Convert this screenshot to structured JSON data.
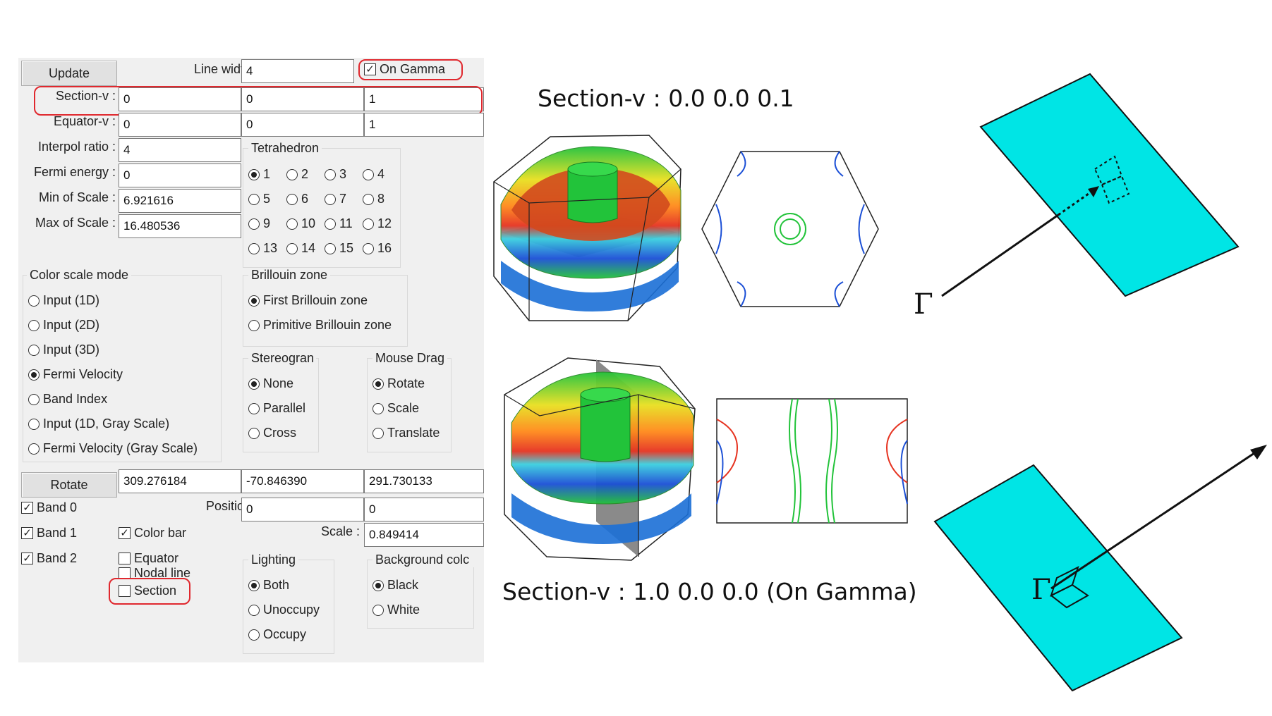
{
  "panel": {
    "update_button": "Update",
    "line_width": {
      "label": "Line width :",
      "value": "4"
    },
    "on_gamma": {
      "label": "On Gamma",
      "checked": true
    },
    "section_v": {
      "label": "Section-v :",
      "values": [
        "0",
        "0",
        "1"
      ]
    },
    "equator_v": {
      "label": "Equator-v :",
      "values": [
        "0",
        "0",
        "1"
      ]
    },
    "interpol_ratio": {
      "label": "Interpol ratio :",
      "value": "4"
    },
    "fermi_energy": {
      "label": "Fermi energy :",
      "value": "0"
    },
    "min_scale": {
      "label": "Min of Scale :",
      "value": "6.921616"
    },
    "max_scale": {
      "label": "Max of Scale :",
      "value": "16.480536"
    },
    "tetrahedron": {
      "title": "Tetrahedron",
      "options": [
        "1",
        "2",
        "3",
        "4",
        "5",
        "6",
        "7",
        "8",
        "9",
        "10",
        "11",
        "12",
        "13",
        "14",
        "15",
        "16"
      ],
      "selected": "1"
    },
    "color_scale_mode": {
      "title": "Color scale mode",
      "options": [
        "Input (1D)",
        "Input (2D)",
        "Input (3D)",
        "Fermi Velocity",
        "Band Index",
        "Input (1D, Gray Scale)",
        "Fermi Velocity (Gray Scale)"
      ],
      "selected": "Fermi Velocity"
    },
    "brillouin_zone": {
      "title": "Brillouin zone",
      "options": [
        "First Brillouin zone",
        "Primitive Brillouin zone"
      ],
      "selected": "First Brillouin zone"
    },
    "stereogram": {
      "title": "Stereogran",
      "options": [
        "None",
        "Parallel",
        "Cross"
      ],
      "selected": "None"
    },
    "mouse_drag": {
      "title": "Mouse Drag",
      "options": [
        "Rotate",
        "Scale",
        "Translate"
      ],
      "selected": "Rotate"
    },
    "rotate": {
      "button": "Rotate",
      "values": [
        "309.276184",
        "-70.846390",
        "291.730133"
      ]
    },
    "band0": {
      "label": "Band 0",
      "checked": true
    },
    "band1": {
      "label": "Band 1",
      "checked": true
    },
    "band2": {
      "label": "Band 2",
      "checked": true
    },
    "color_bar": {
      "label": "Color bar",
      "checked": true
    },
    "equator": {
      "label": "Equator",
      "checked": false
    },
    "nodal_line": {
      "label": "Nodal line",
      "checked": false
    },
    "section": {
      "label": "Section",
      "checked": false
    },
    "position": {
      "label": "Position :",
      "values": [
        "0",
        "0"
      ]
    },
    "scale": {
      "label": "Scale :",
      "value": "0.849414"
    },
    "lighting": {
      "title": "Lighting",
      "options": [
        "Both",
        "Unoccupy",
        "Occupy"
      ],
      "selected": "Both"
    },
    "background_color": {
      "title": "Background colc",
      "options": [
        "Black",
        "White"
      ],
      "selected": "Black"
    }
  },
  "captions": {
    "top": "Section-v : 0.0 0.0 0.1",
    "bottom": "Section-v : 1.0 0.0 0.0 (On Gamma)"
  },
  "diagram": {
    "gamma_top": "Γ",
    "gamma_bottom": "Γ",
    "plane_color": "#00e5e5"
  },
  "colors": {
    "highlight": "#e0282e",
    "fermi_green": "#22c33a",
    "fermi_blue": "#1b4fd6"
  }
}
